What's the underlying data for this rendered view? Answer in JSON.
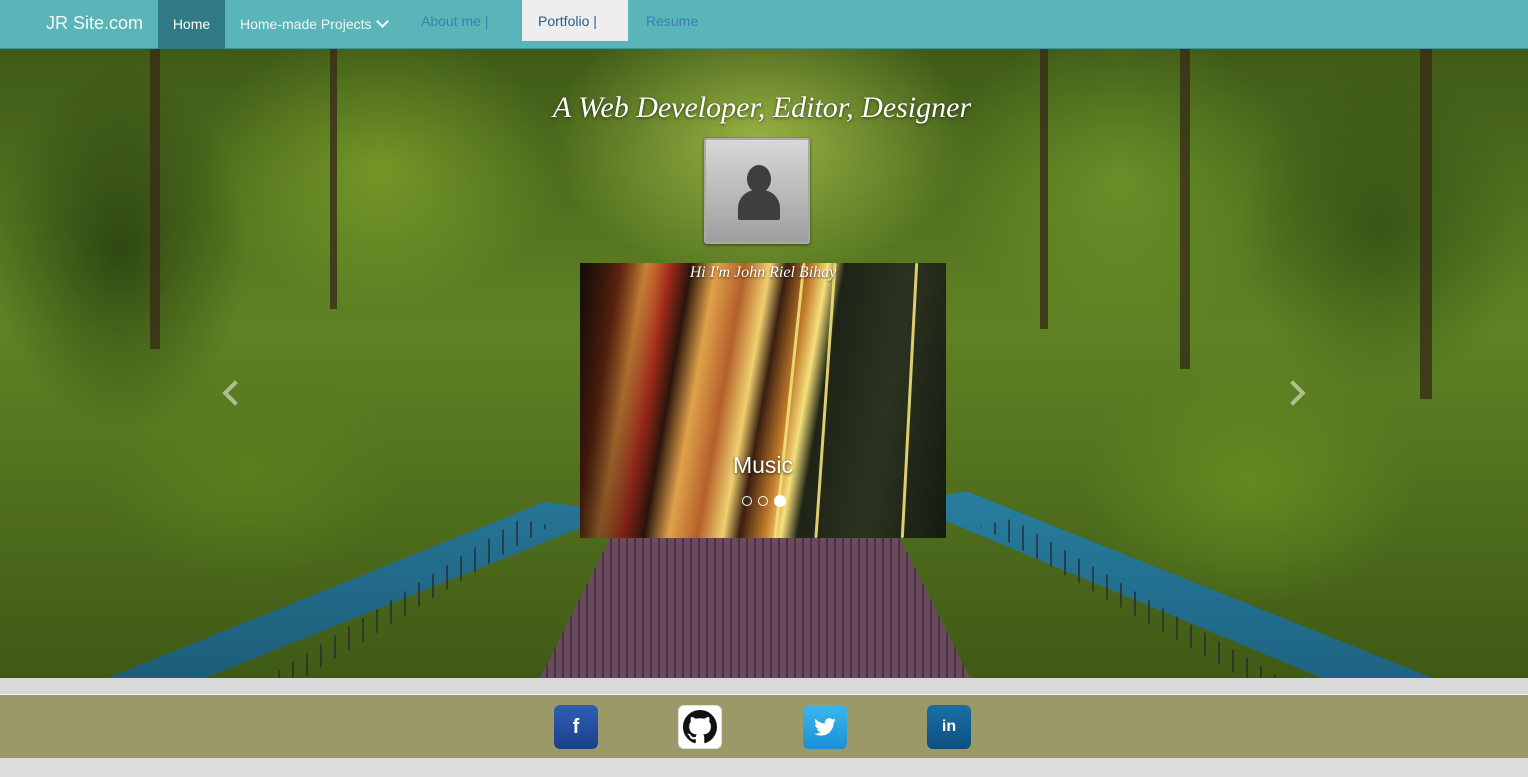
{
  "navbar": {
    "brand": "JR Site.com",
    "items": [
      {
        "label": "Home",
        "active": true
      },
      {
        "label": "Home-made Projects"
      },
      {
        "label": "About me |"
      },
      {
        "label": "Portfolio |"
      },
      {
        "label": "Resume"
      }
    ]
  },
  "hero": {
    "title": "A Web Developer, Editor, Designer",
    "greeting": "Hi I'm John Riel Bihay"
  },
  "carousel": {
    "caption": "Music",
    "slide_count": 3,
    "active_slide": 3
  },
  "footer": {
    "social_icons": [
      "facebook-icon",
      "github-icon",
      "twitter-icon",
      "linkedin-icon"
    ]
  },
  "colors": {
    "navbar_bg": "#5ab5b8",
    "nav_active_bg": "#2f7a85",
    "footer_bg": "#9c9968"
  }
}
